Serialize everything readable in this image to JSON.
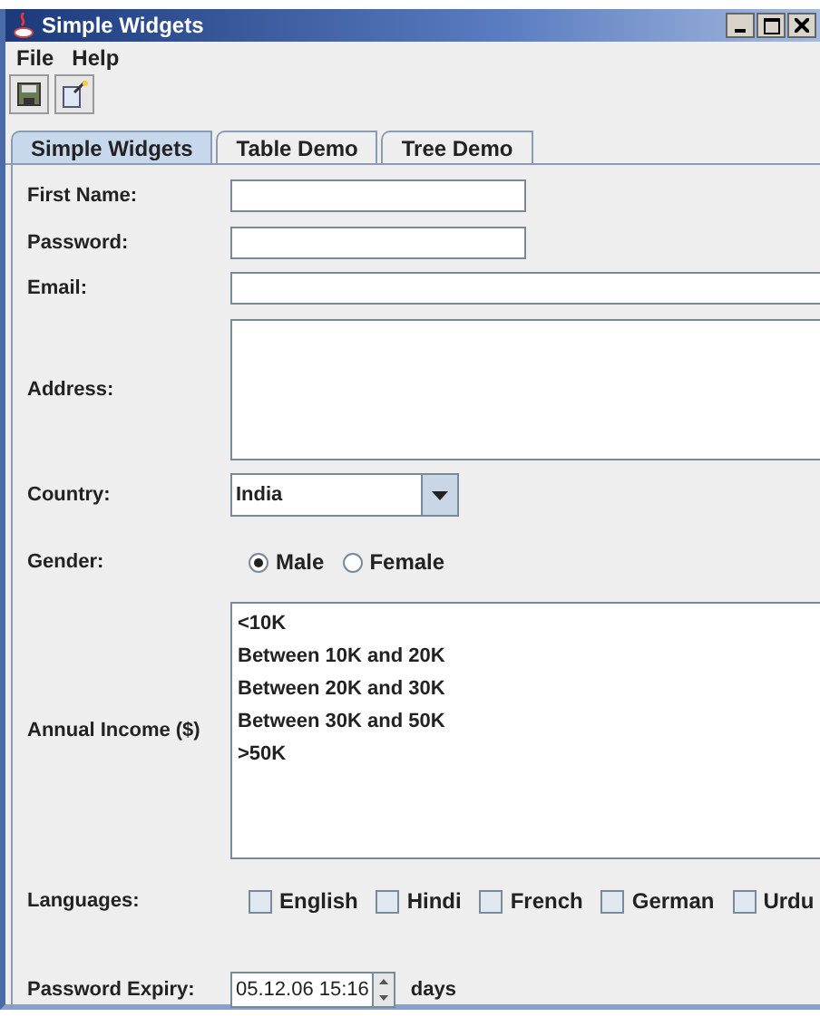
{
  "window": {
    "title": "Simple Widgets"
  },
  "menu": [
    "File",
    "Help"
  ],
  "tabs": [
    {
      "label": "Simple Widgets",
      "selected": true
    },
    {
      "label": "Table Demo",
      "selected": false
    },
    {
      "label": "Tree Demo",
      "selected": false
    }
  ],
  "form": [
    {
      "kind": "short",
      "label": "First Name:"
    },
    {
      "kind": "short",
      "label": "Password:"
    },
    {
      "kind": "wide",
      "label": "Email:"
    },
    {
      "kind": "area",
      "label": "Address:"
    },
    {
      "kind": "combo",
      "label": "Country:",
      "value": "India"
    },
    {
      "kind": "radio",
      "label": "Gender:",
      "options": [
        {
          "label": "Male",
          "selected": true
        },
        {
          "label": "Female",
          "selected": false
        }
      ]
    },
    {
      "kind": "list",
      "label": "Annual Income ($)",
      "items": [
        "<10K",
        "Between 10K and 20K",
        "Between 20K and 30K",
        "Between 30K and 50K",
        ">50K"
      ]
    },
    {
      "kind": "checks",
      "label": "Languages:",
      "options": [
        {
          "label": "English",
          "checked": false
        },
        {
          "label": "Hindi",
          "checked": false
        },
        {
          "label": "French",
          "checked": false
        },
        {
          "label": "German",
          "checked": false
        },
        {
          "label": "Urdu",
          "checked": false
        }
      ]
    },
    {
      "kind": "spinner",
      "label": "Password Expiry:",
      "value": "05.12.06 15:16",
      "suffix": "days"
    }
  ]
}
